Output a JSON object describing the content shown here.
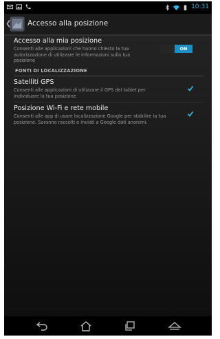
{
  "status_bar": {
    "time": "10:31",
    "left_icons": [
      "mail-icon",
      "image-icon",
      "phone-call-icon"
    ],
    "right_icons": [
      "bluetooth-icon",
      "wifi-icon",
      "battery-icon"
    ]
  },
  "action_bar": {
    "title": "Accesso alla posizione",
    "app_icon": "location-settings-icon"
  },
  "settings": {
    "access": {
      "title": "Accesso alla mia posizione",
      "summary": "Consenti alle applicazioni che hanno chiesto la tua autorizzazione di utilizzare le informazioni sulla tua posizione",
      "toggle_label": "ON",
      "enabled": true
    },
    "section_header": "FONTI DI LOCALIZZAZIONE",
    "gps": {
      "title": "Satelliti GPS",
      "summary": "Consenti alle applicazioni di utilizzare il GPS del tablet per individuare la tua posizione",
      "checked": true
    },
    "wifi": {
      "title": "Posizione Wi-Fi e rete mobile",
      "summary": "Consenti alle app di usare localizzazione Google per stabilire la tua posizione. Saranno raccolti e inviati a Google dati anonimi.",
      "checked": true
    }
  },
  "nav_bar": {
    "buttons": [
      "back-icon",
      "home-icon",
      "recent-apps-icon",
      "menu-up-icon"
    ]
  },
  "colors": {
    "accent": "#33b5e5",
    "toggle_on": "#1c8fc4",
    "background": "#1a1a1a"
  }
}
